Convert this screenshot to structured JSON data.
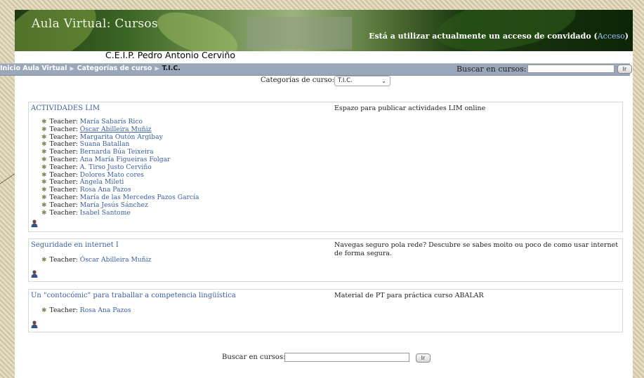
{
  "header": {
    "site_title": "Aula Virtual: Cursos",
    "guest_note": "Está a utilizar actualmente un acceso de convidado (",
    "login_link": "Acceso",
    "guest_note_end": ")",
    "school_name": "C.E.I.P. Pedro Antonio Cerviño"
  },
  "navbar": {
    "breadcrumb": [
      "Inicio Aula Virtual",
      "Categorías de curso",
      "T.I.C."
    ],
    "separator": "▶",
    "search_label": "Buscar en cursos:",
    "search_value": "",
    "go_label": "Ir"
  },
  "category": {
    "label": "Categorías de curso:",
    "selected": "T.I.C."
  },
  "courses": [
    {
      "name": "ACTIVIDADES LIM",
      "summary": "Espazo para publicar actividades LIM online",
      "teachers": [
        {
          "role": "Teacher:",
          "name": "María Sabarís Rico"
        },
        {
          "role": "Teacher:",
          "name": "Óscar Abilleira Muñiz"
        },
        {
          "role": "Teacher:",
          "name": "Margarita Outón Argibay"
        },
        {
          "role": "Teacher:",
          "name": "Suana Batallan"
        },
        {
          "role": "Teacher:",
          "name": "Bernarda Búa Teixeira"
        },
        {
          "role": "Teacher:",
          "name": "Ana María Figueiras Folgar"
        },
        {
          "role": "Teacher:",
          "name": "A. Tirso Justo Cerviño"
        },
        {
          "role": "Teacher:",
          "name": "Dolores Mato cores"
        },
        {
          "role": "Teacher:",
          "name": "Ángela Mileti"
        },
        {
          "role": "Teacher:",
          "name": "Rosa Ana Pazos"
        },
        {
          "role": "Teacher:",
          "name": "María de las Mercedes Pazos García"
        },
        {
          "role": "Teacher:",
          "name": "María Jesús Sánchez"
        },
        {
          "role": "Teacher:",
          "name": "Isabel Santome"
        }
      ]
    },
    {
      "name": "Seguridade en internet I",
      "summary": "Navegas seguro pola rede? Descubre se sabes moito ou poco de como usar internet de forma segura.",
      "teachers": [
        {
          "role": "Teacher:",
          "name": "Óscar Abilleira Muñiz"
        }
      ]
    },
    {
      "name": "Un \"contocómic\" para traballar a competencia lingüística",
      "summary": "Material de PT para práctica curso ABALAR",
      "teachers": [
        {
          "role": "Teacher:",
          "name": "Rosa Ana Pazos"
        }
      ]
    }
  ],
  "bottom_search": {
    "label": "Buscar en cursos:",
    "value": "",
    "go_label": "Ir"
  },
  "icons": {
    "guest_access": "guest-user-icon",
    "bullet": "star-bullet-icon",
    "dropdown": "chevron-down-icon"
  },
  "colors": {
    "link": "#3a5f9e",
    "navbar": "#9aa7b9",
    "banner_dark": "#1e3a12"
  }
}
